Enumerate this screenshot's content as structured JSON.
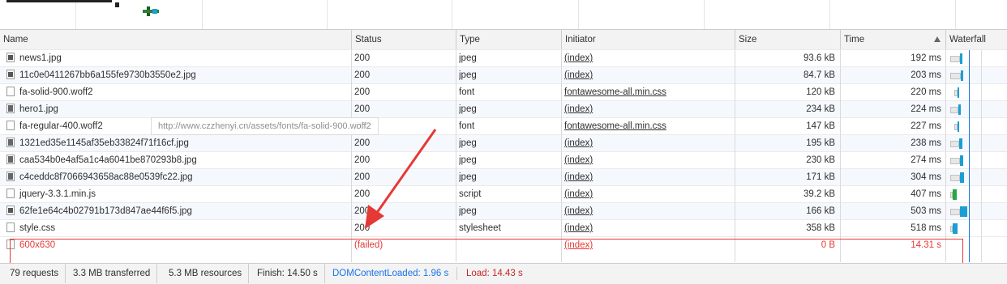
{
  "columns": {
    "name": "Name",
    "status": "Status",
    "type": "Type",
    "initiator": "Initiator",
    "size": "Size",
    "time": "Time",
    "waterfall": "Waterfall"
  },
  "rows": [
    {
      "name": "news1.jpg",
      "status": "200",
      "type": "jpeg",
      "initiator": "(index)",
      "size": "93.6 kB",
      "time": "192 ms"
    },
    {
      "name": "11c0e0411267bb6a155fe9730b3550e2.jpg",
      "status": "200",
      "type": "jpeg",
      "initiator": "(index)",
      "size": "84.7 kB",
      "time": "203 ms"
    },
    {
      "name": "fa-solid-900.woff2",
      "status": "200",
      "type": "font",
      "initiator": "fontawesome-all.min.css",
      "size": "120 kB",
      "time": "220 ms"
    },
    {
      "name": "hero1.jpg",
      "status": "200",
      "type": "jpeg",
      "initiator": "(index)",
      "size": "234 kB",
      "time": "224 ms"
    },
    {
      "name": "fa-regular-400.woff2",
      "status": "200",
      "type": "font",
      "initiator": "fontawesome-all.min.css",
      "size": "147 kB",
      "time": "227 ms"
    },
    {
      "name": "1321ed35e1145af35eb33824f71f16cf.jpg",
      "status": "200",
      "type": "jpeg",
      "initiator": "(index)",
      "size": "195 kB",
      "time": "238 ms"
    },
    {
      "name": "caa534b0e4af5a1c4a6041be870293b8.jpg",
      "status": "200",
      "type": "jpeg",
      "initiator": "(index)",
      "size": "230 kB",
      "time": "274 ms"
    },
    {
      "name": "c4ceddc8f7066943658ac88e0539fc22.jpg",
      "status": "200",
      "type": "jpeg",
      "initiator": "(index)",
      "size": "171 kB",
      "time": "304 ms"
    },
    {
      "name": "jquery-3.3.1.min.js",
      "status": "200",
      "type": "script",
      "initiator": "(index)",
      "size": "39.2 kB",
      "time": "407 ms"
    },
    {
      "name": "62fe1e64c4b02791b173d847ae44f6f5.jpg",
      "status": "200",
      "type": "jpeg",
      "initiator": "(index)",
      "size": "166 kB",
      "time": "503 ms"
    },
    {
      "name": "style.css",
      "status": "200",
      "type": "stylesheet",
      "initiator": "(index)",
      "size": "358 kB",
      "time": "518 ms"
    },
    {
      "name": "600x630",
      "status": "(failed)",
      "type": "",
      "initiator": "(index)",
      "size": "0 B",
      "time": "14.31 s"
    }
  ],
  "tooltip": "http://www.czzhenyi.cn/assets/fonts/fa-solid-900.woff2",
  "statusbar": {
    "requests": "79 requests",
    "transferred": "3.3 MB transferred",
    "resources": "5.3 MB resources",
    "finish": "Finish: 14.50 s",
    "domcontentloaded": "DOMContentLoaded: 1.96 s",
    "load": "Load: 14.43 s"
  },
  "colors": {
    "failed": "#e53935",
    "domcontentloaded": "#1a73e8",
    "load": "#c62828",
    "waterfall_bar": "#1a9fd4"
  }
}
